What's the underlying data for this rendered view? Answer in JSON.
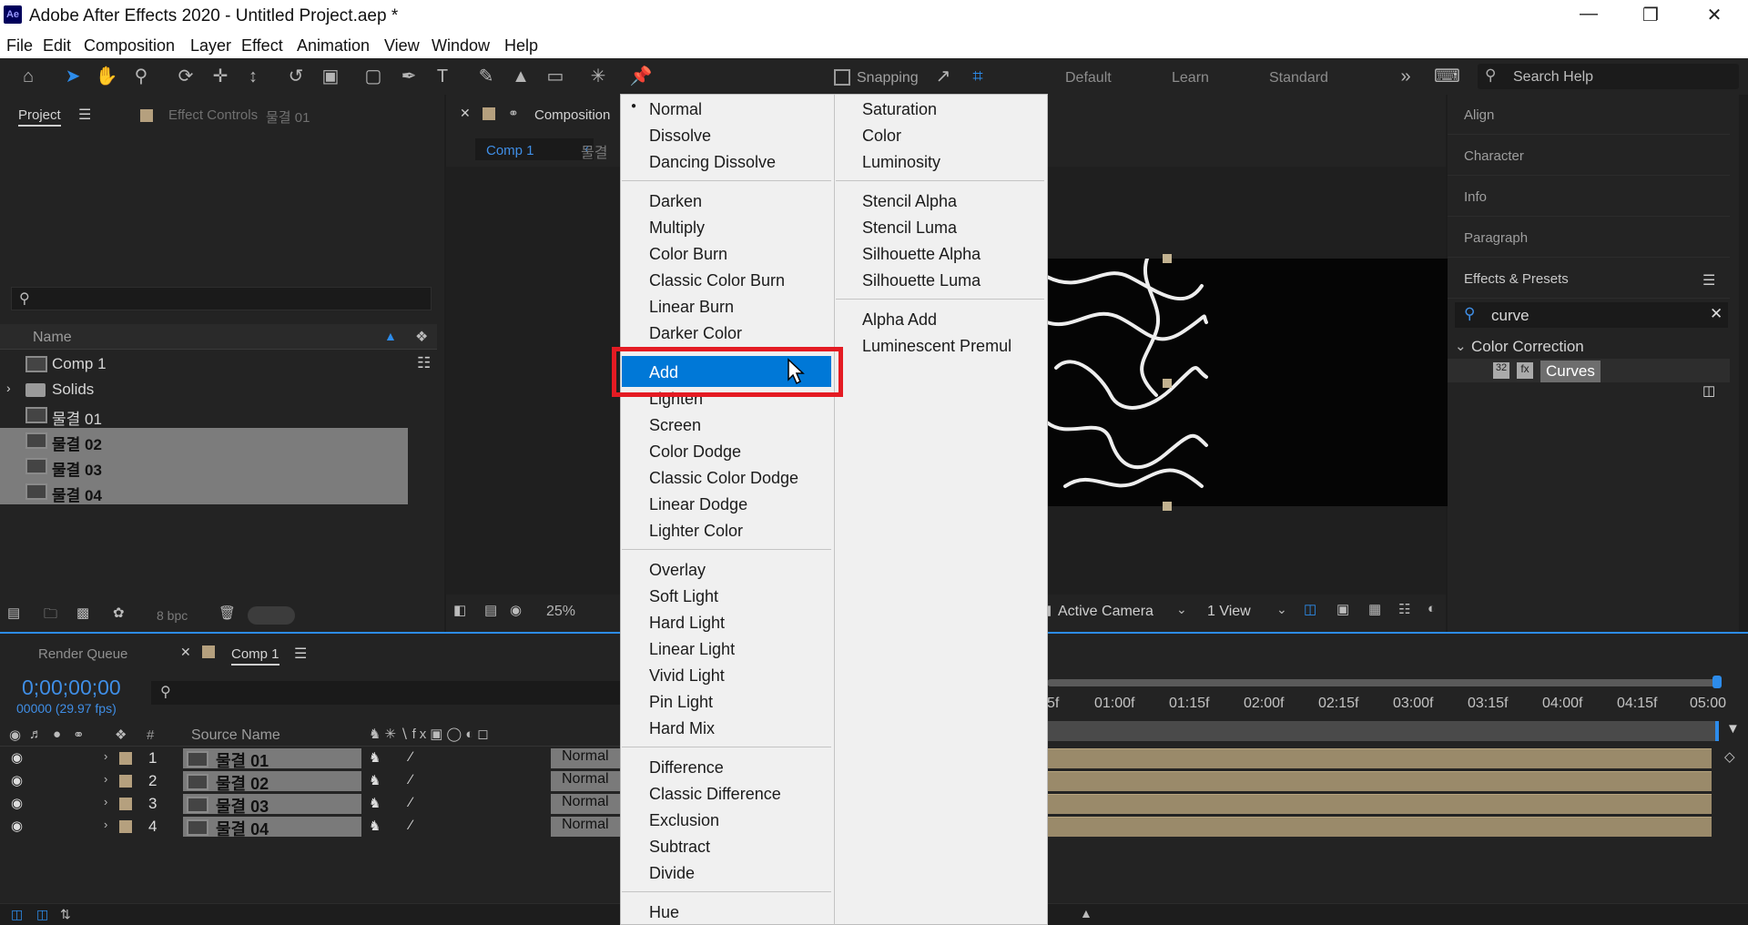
{
  "app": {
    "title": "Adobe After Effects 2020 - Untitled Project.aep *",
    "logo": "Ae"
  },
  "menubar": [
    "File",
    "Edit",
    "Composition",
    "Layer",
    "Effect",
    "Animation",
    "View",
    "Window",
    "Help"
  ],
  "toolbar": {
    "snapping": "Snapping",
    "workspaces": [
      "Default",
      "Learn",
      "Standard"
    ],
    "search_placeholder": "Search Help"
  },
  "project_panel": {
    "tab_project": "Project",
    "tab_effect_controls": "Effect Controls",
    "effect_controls_target": "물결 01",
    "column_name": "Name",
    "items": [
      {
        "name": "Comp 1",
        "selected": false
      },
      {
        "name": "Solids",
        "selected": false
      },
      {
        "name": "물결 01",
        "selected": false
      },
      {
        "name": "물결 02",
        "selected": true
      },
      {
        "name": "물결 03",
        "selected": true
      },
      {
        "name": "물결 04",
        "selected": true
      }
    ],
    "bpc": "8 bpc"
  },
  "composition_panel": {
    "tab": "Composition",
    "crumb": "Comp 1",
    "crumb2": "물결",
    "zoom": "25%",
    "camera": "Active Camera",
    "view": "1 View"
  },
  "right_panel": {
    "items": [
      "Align",
      "Character",
      "Info",
      "Paragraph",
      "Effects & Presets"
    ],
    "search_value": "curve",
    "category": "Color Correction",
    "effect": "Curves"
  },
  "blend_menu": {
    "col1": [
      [
        "Normal",
        "Dissolve",
        "Dancing Dissolve"
      ],
      [
        "Darken",
        "Multiply",
        "Color Burn",
        "Classic Color Burn",
        "Linear Burn",
        "Darker Color"
      ],
      [
        "Add",
        "Lighten",
        "Screen",
        "Color Dodge",
        "Classic Color Dodge",
        "Linear Dodge",
        "Lighter Color"
      ],
      [
        "Overlay",
        "Soft Light",
        "Hard Light",
        "Linear Light",
        "Vivid Light",
        "Pin Light",
        "Hard Mix"
      ],
      [
        "Difference",
        "Classic Difference",
        "Exclusion",
        "Subtract",
        "Divide"
      ],
      [
        "Hue"
      ]
    ],
    "col2": [
      [
        "Saturation",
        "Color",
        "Luminosity"
      ],
      [
        "Stencil Alpha",
        "Stencil Luma",
        "Silhouette Alpha",
        "Silhouette Luma"
      ],
      [
        "Alpha Add",
        "Luminescent Premul"
      ]
    ],
    "checked": "Normal",
    "highlighted": "Add"
  },
  "timeline": {
    "tab_render_queue": "Render Queue",
    "tab_comp": "Comp 1",
    "timecode": "0;00;00;00",
    "frames": "00000 (29.97 fps)",
    "col_num": "#",
    "col_source": "Source Name",
    "layers": [
      {
        "num": "1",
        "name": "물결 01",
        "mode": "Normal"
      },
      {
        "num": "2",
        "name": "물결 02",
        "mode": "Normal"
      },
      {
        "num": "3",
        "name": "물결 03",
        "mode": "Normal"
      },
      {
        "num": "4",
        "name": "물결 04",
        "mode": "Normal"
      }
    ],
    "ruler": [
      "5f",
      "01:00f",
      "01:15f",
      "02:00f",
      "02:15f",
      "03:00f",
      "03:15f",
      "04:00f",
      "04:15f",
      "05:00"
    ]
  }
}
